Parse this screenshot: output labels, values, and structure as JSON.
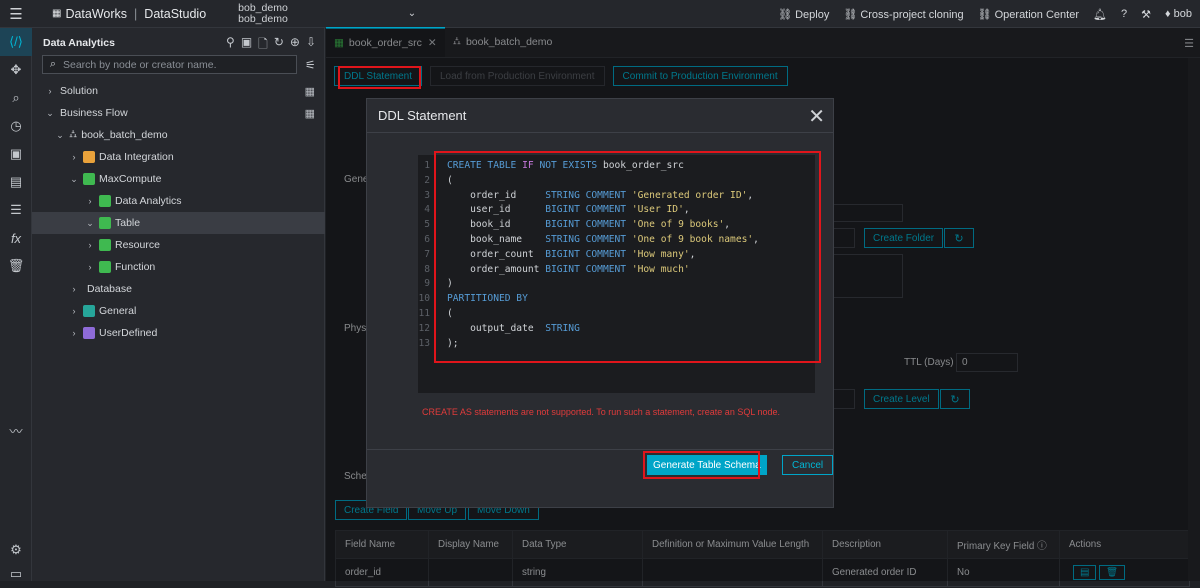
{
  "topbar": {
    "product": "DataWorks",
    "module": "DataStudio",
    "workspace_line1": "bob_demo",
    "workspace_line2": "bob_demo",
    "deploy": "Deploy",
    "cross": "Cross-project cloning",
    "ops": "Operation Center",
    "user": "bob"
  },
  "sidebar": {
    "title": "Data Analytics",
    "search_placeholder": "Search by node or creator name.",
    "tree": [
      "Solution",
      "Business Flow",
      "book_batch_demo",
      "Data Integration",
      "MaxCompute",
      "Data Analytics",
      "Table",
      "Resource",
      "Function",
      "Database",
      "General",
      "UserDefined"
    ]
  },
  "tabs": {
    "tab1": "book_order_src",
    "tab2": "book_batch_demo"
  },
  "toolbar": {
    "ddl": "DDL Statement",
    "load": "Load from Production Environment",
    "commit": "Commit to Production Environment"
  },
  "dialog": {
    "title": "DDL Statement",
    "error": "CREATE AS statements are not supported. To run such a statement, create an SQL node.",
    "generate": "Generate Table Schema",
    "cancel": "Cancel"
  },
  "background": {
    "gen": "Gene",
    "phys": "Phys",
    "sche": "Sche",
    "create_folder": "Create Folder",
    "ttl_label": "TTL (Days)",
    "ttl_value": "0",
    "create_level": "Create Level",
    "create_field": "Create Field",
    "move_up": "Move Up",
    "move_down": "Move Down"
  },
  "table": {
    "headers": [
      "Field Name",
      "Display Name",
      "Data Type",
      "Definition or Maximum Value Length",
      "Description",
      "Primary Key Field",
      "Actions"
    ],
    "rows": [
      [
        "order_id",
        "",
        "string",
        "",
        "Generated order ID",
        "No"
      ]
    ]
  }
}
